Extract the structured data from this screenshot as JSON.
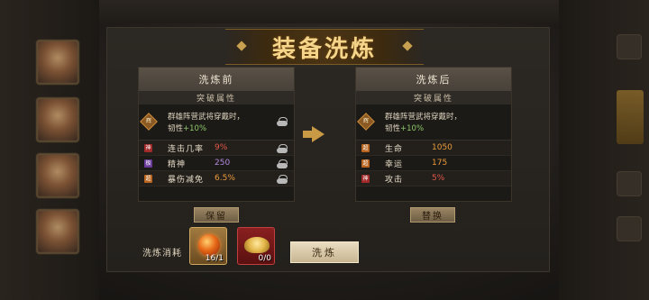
{
  "window": {
    "title": "装备洗炼"
  },
  "before": {
    "header": "洗炼前",
    "subheader": "突破属性",
    "skill": {
      "rank_label": "辉",
      "line1": "群雄阵营武将穿戴时，",
      "line2_prefix": "韧性",
      "line2_value": "+10%"
    },
    "attributes": [
      {
        "badge": "神",
        "name": "连击几率",
        "value": "9%",
        "color": "red"
      },
      {
        "badge": "极",
        "name": "精神",
        "value": "250",
        "color": "purple"
      },
      {
        "badge": "超",
        "name": "暴伤减免",
        "value": "6.5%",
        "color": "orange"
      }
    ],
    "button_label": "保留"
  },
  "after": {
    "header": "洗炼后",
    "subheader": "突破属性",
    "skill": {
      "rank_label": "辉",
      "line1": "群雄阵营武将穿戴时，",
      "line2_prefix": "韧性",
      "line2_value": "+10%"
    },
    "attributes": [
      {
        "badge": "超",
        "name": "生命",
        "value": "1050",
        "color": "orange"
      },
      {
        "badge": "超",
        "name": "幸运",
        "value": "175",
        "color": "orange"
      },
      {
        "badge": "神",
        "name": "攻击",
        "value": "5%",
        "color": "red"
      }
    ],
    "button_label": "替换"
  },
  "cost": {
    "label": "洗炼消耗",
    "items": [
      {
        "icon": "fire-orb-icon",
        "count": "16/1"
      },
      {
        "icon": "gold-ingot-icon",
        "count": "0/0"
      }
    ]
  },
  "refine_button": "洗炼",
  "colors": {
    "accent": "#f4d58a",
    "red": "#e05848",
    "purple": "#b48ae0",
    "orange": "#e89a3a",
    "green": "#8ec86a"
  }
}
